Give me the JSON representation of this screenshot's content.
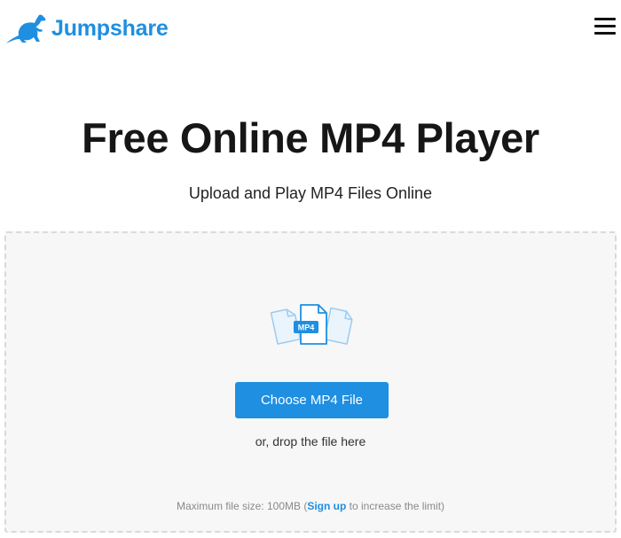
{
  "brand": {
    "name": "Jumpshare",
    "color": "#1e8fe1",
    "logo_icon": "kangaroo-icon"
  },
  "header": {
    "menu_icon": "hamburger-menu-icon"
  },
  "hero": {
    "title": "Free Online MP4 Player",
    "subtitle": "Upload and Play MP4 Files Online"
  },
  "upload": {
    "file_badge": "MP4",
    "button_label": "Choose MP4 File",
    "drop_hint": "or, drop the file here",
    "limit_prefix": "Maximum file size: 100MB (",
    "signup_link": "Sign up",
    "limit_suffix": " to increase the limit)"
  }
}
